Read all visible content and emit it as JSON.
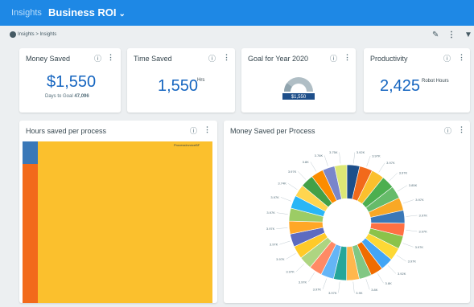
{
  "topbar": {
    "breadcrumb_root": "Insights",
    "title": "Business ROI",
    "chevron": "⌄"
  },
  "subbar": {
    "breadcrumb": "Insights > Insights",
    "edit_icon": "pencil-icon",
    "menu_icon": "more-vert-icon",
    "filter_icon": "filter-icon"
  },
  "icons": {
    "info": "ⓘ",
    "menu": "⋮",
    "pencil": "✎",
    "filter": "⏷"
  },
  "cards": {
    "money_saved": {
      "title": "Money Saved",
      "value": "$1,550",
      "sub_label": "Days to Goal",
      "sub_value": "47,096"
    },
    "time_saved": {
      "title": "Time Saved",
      "value": "1,550",
      "unit": "Hrs"
    },
    "goal": {
      "title": "Goal for Year 2020",
      "badge": "$1,550",
      "progress": 0.2
    },
    "productivity": {
      "title": "Productivity",
      "value": "2,425",
      "unit": "Robot Hours"
    },
    "hours_per_process": {
      "title": "Hours saved per process",
      "label": "ProcessInvoiceBF"
    },
    "money_per_process": {
      "title": "Money Saved per Process"
    }
  },
  "colors": {
    "topbar": "#1e88e5",
    "value_blue": "#1565c0",
    "treemap_blue": "#3a78b8",
    "treemap_orange": "#f26a1b",
    "treemap_yellow": "#fbc02d",
    "gauge_fill": "#90a4ae",
    "gauge_badge": "#1e4f8a"
  },
  "chart_data": {
    "type": "pie",
    "title": "Money Saved per Process",
    "donut": true,
    "slice_colors": [
      "#1e4f8a",
      "#f26a1b",
      "#fbc02d",
      "#4caf50",
      "#66bb6a",
      "#f9a825",
      "#3a78b8",
      "#ff7043",
      "#8bc34a",
      "#fdd835",
      "#42a5f5",
      "#ef6c00",
      "#81c784",
      "#ffb74d",
      "#26a69a",
      "#64b5f6",
      "#ff8a65",
      "#aed581",
      "#ffca28",
      "#5c6bc0",
      "#ffa726",
      "#9ccc65",
      "#29b6f6",
      "#ffd54f",
      "#43a047",
      "#fb8c00",
      "#7986cb",
      "#dce775"
    ],
    "labels": [
      "3.92K",
      "3.97K",
      "3.97K",
      "3.97K",
      "3.85K",
      "3.97K",
      "3.97K",
      "3.97K",
      "3.97K",
      "3.97K",
      "3.92K",
      "3.8K",
      "3.8K",
      "3.9K",
      "3.97K",
      "3.97K",
      "3.97K",
      "3.97K",
      "3.97K",
      "3.97K",
      "3.97K",
      "3.97K",
      "3.97K",
      "3.74K",
      "3.97K",
      "3.8K",
      "3.76K",
      "3.75K"
    ],
    "values": [
      3920,
      3970,
      3970,
      3970,
      3850,
      3970,
      3970,
      3970,
      3970,
      3970,
      3920,
      3800,
      3800,
      3900,
      3970,
      3970,
      3970,
      3970,
      3970,
      3970,
      3970,
      3970,
      3970,
      3740,
      3970,
      3800,
      3760,
      3750
    ]
  }
}
